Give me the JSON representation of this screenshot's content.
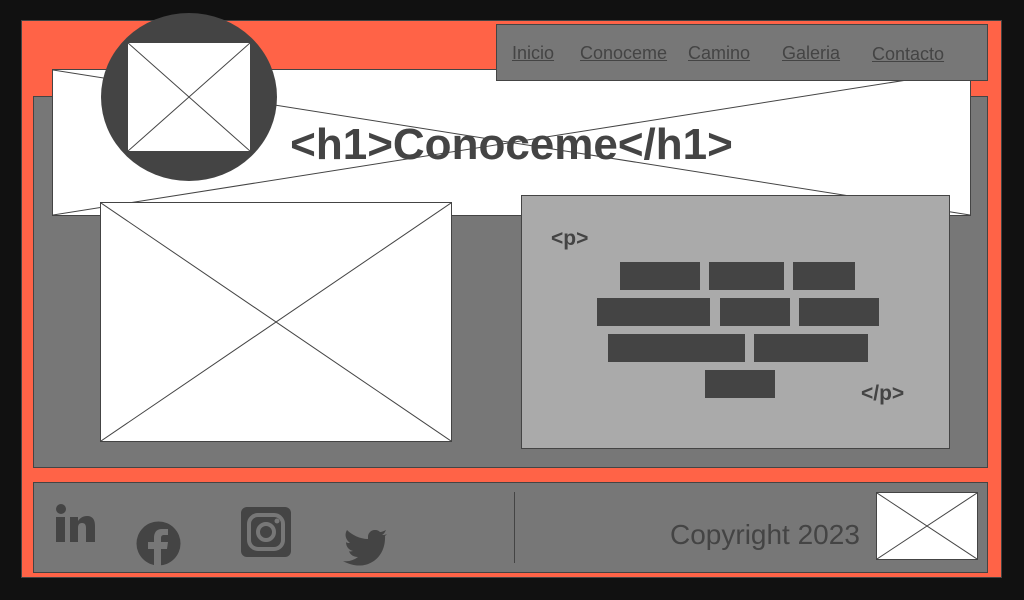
{
  "nav": {
    "items": [
      "Inicio",
      "Conoceme",
      "Camino",
      "Galeria",
      "Contacto"
    ]
  },
  "hero": {
    "title": "<h1>Conoceme</h1>"
  },
  "text_block": {
    "open_tag": "<p>",
    "close_tag": "</p>"
  },
  "footer": {
    "social": [
      "linkedin-icon",
      "facebook-icon",
      "instagram-icon",
      "twitter-icon"
    ],
    "copyright": "Copyright 2023"
  },
  "colors": {
    "frame": "#ff6347",
    "panel": "#777777",
    "text_box": "#aaaaaa",
    "dark": "#444444"
  }
}
